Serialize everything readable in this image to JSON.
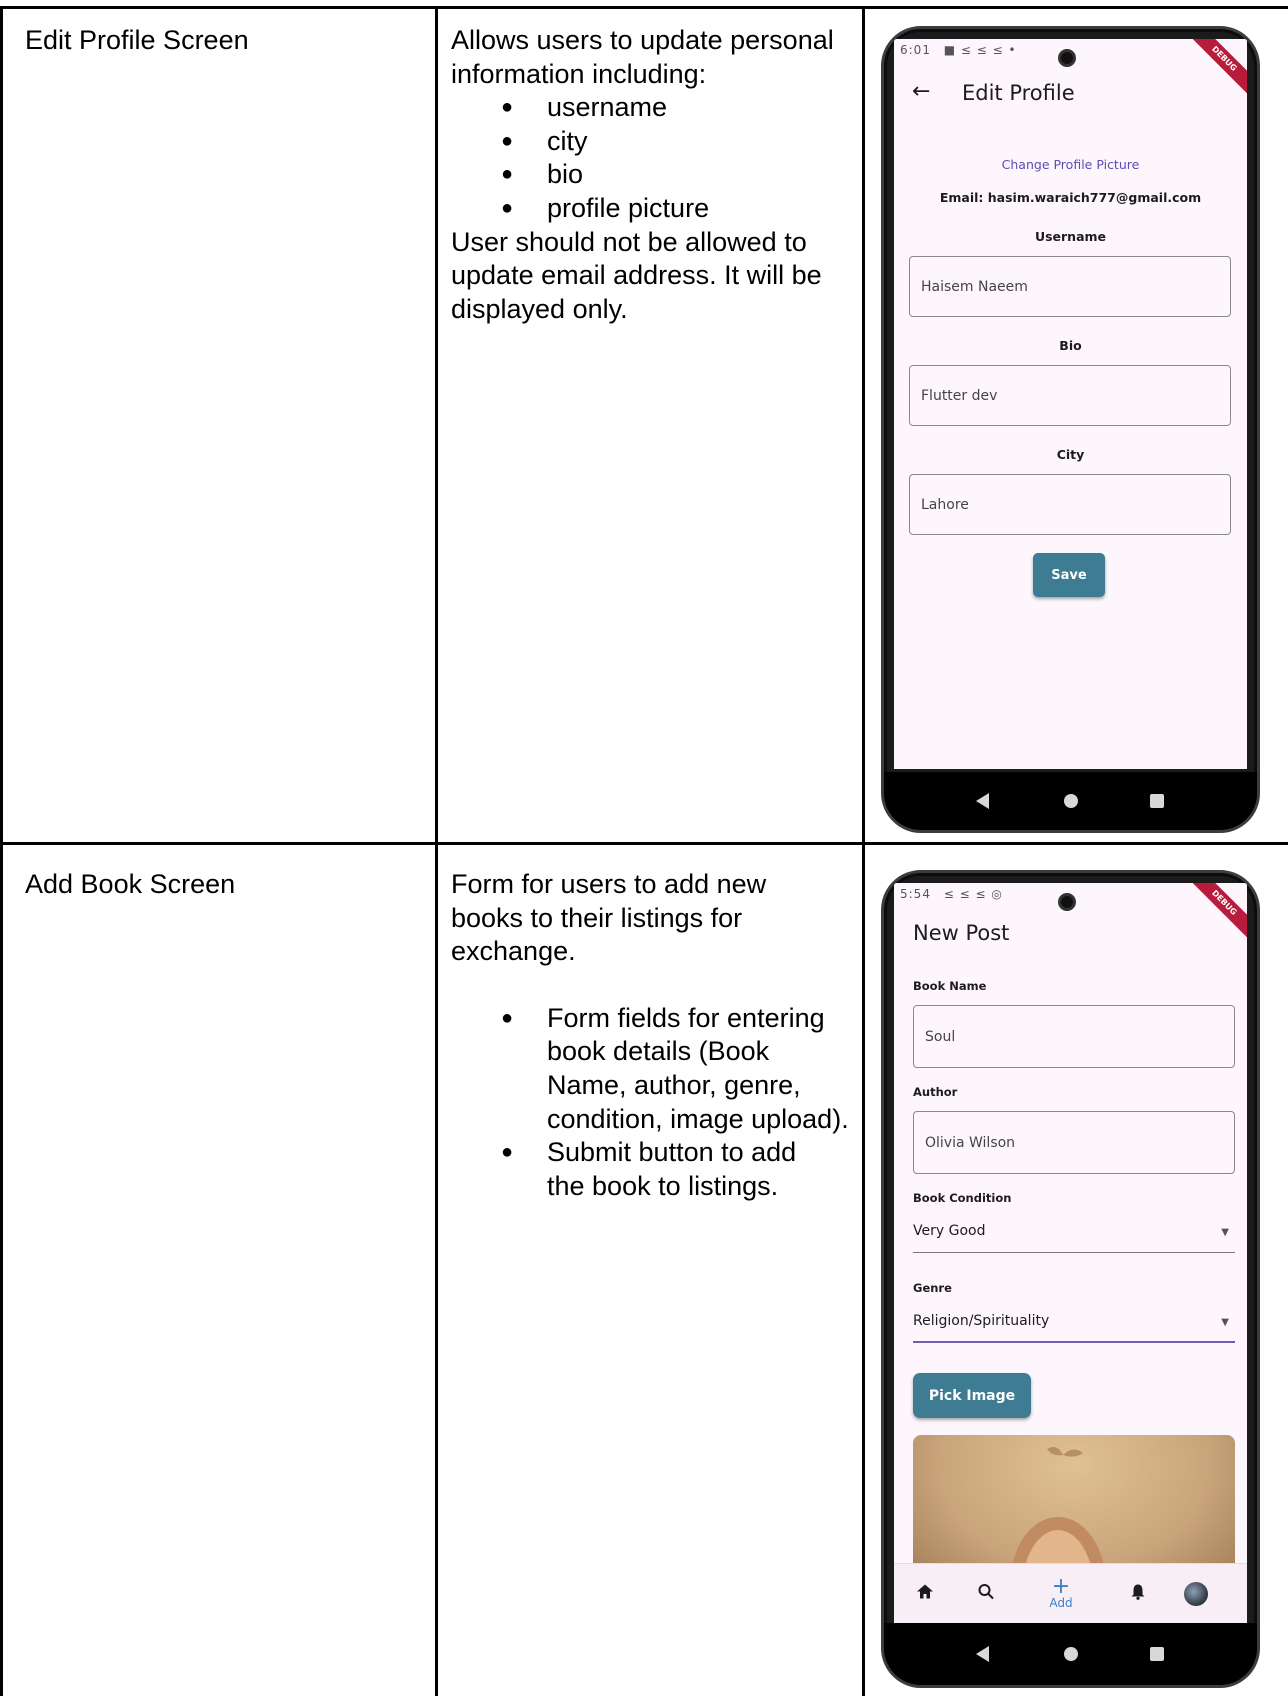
{
  "rows": [
    {
      "screen_name": "Edit Profile Screen",
      "description_intro": "Allows users to update personal information including:",
      "description_bullets": [
        "username",
        "city",
        "bio",
        "profile picture"
      ],
      "description_outro": "User should not be allowed to update email address. It will be displayed only.",
      "phone": {
        "status_time": "6:01",
        "status_icons": "■ ≤ ≤ ≤ •",
        "debug_badge": "DEBUG",
        "appbar_title": "Edit Profile",
        "back_icon": "arrow-left-icon",
        "change_picture_link": "Change Profile Picture",
        "email_text": "Email: hasim.waraich777@gmail.com",
        "fields": [
          {
            "label": "Username",
            "value": "Haisem Naeem"
          },
          {
            "label": "Bio",
            "value": "Flutter dev"
          },
          {
            "label": "City",
            "value": "Lahore"
          }
        ],
        "save_label": "Save",
        "accent_color": "#3e7c93"
      }
    },
    {
      "screen_name": "Add Book Screen",
      "description_intro": "Form for users to add new books to their listings for exchange.",
      "description_bullets": [
        "Form fields for entering book details (Book Name, author, genre, condition, image upload).",
        "Submit button to add the book to listings."
      ],
      "phone": {
        "status_time": "5:54",
        "status_icons": "≤ ≤ ≤ ◎",
        "debug_badge": "DEBUG",
        "appbar_title": "New Post",
        "book_name_label": "Book Name",
        "book_name_value": "Soul",
        "author_label": "Author",
        "author_value": "Olivia Wilson",
        "condition_label": "Book Condition",
        "condition_value": "Very Good",
        "genre_label": "Genre",
        "genre_value": "Religion/Spirituality",
        "pick_image_label": "Pick Image",
        "bottom_nav": {
          "home_icon": "home-icon",
          "search_icon": "search-icon",
          "add_label": "Add",
          "notifications_icon": "bell-icon",
          "profile_icon": "avatar-icon"
        },
        "accent_color": "#3e7c93"
      }
    }
  ]
}
